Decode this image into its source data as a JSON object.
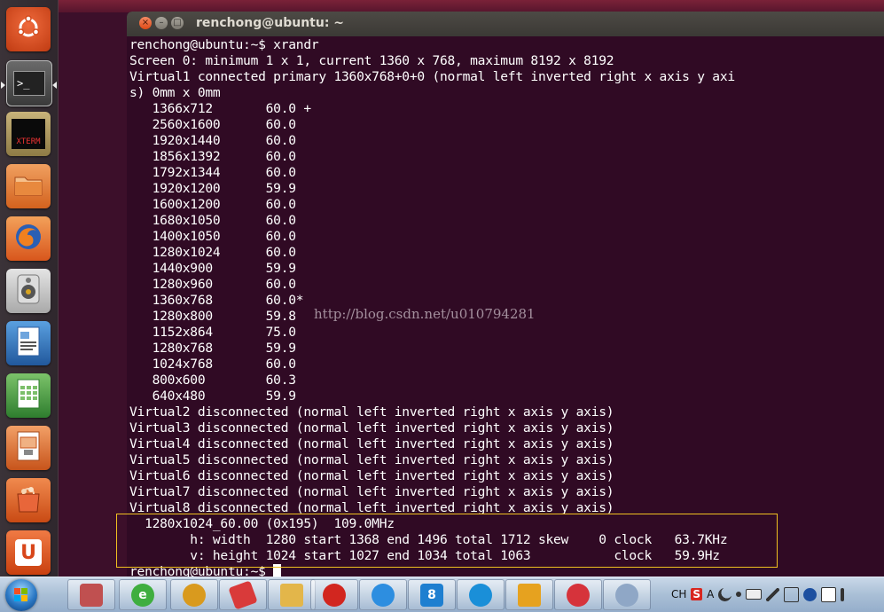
{
  "window": {
    "title": "renchong@ubuntu: ~",
    "close_glyph": "×",
    "min_glyph": "–",
    "max_glyph": "□"
  },
  "launcher": {
    "items": [
      {
        "name": "dash-home",
        "label": "",
        "color": "#d44b1e"
      },
      {
        "name": "terminal",
        "label": ">_",
        "color": "#2b2b2b"
      },
      {
        "name": "xterm",
        "label": "XTERM",
        "color": "#1a1a1a"
      },
      {
        "name": "files",
        "label": "",
        "color": "#e07b2e"
      },
      {
        "name": "firefox",
        "label": "",
        "color": "#e5672d"
      },
      {
        "name": "rhythmbox",
        "label": "",
        "color": "#c9c9c9"
      },
      {
        "name": "writer",
        "label": "",
        "color": "#2f6fb7"
      },
      {
        "name": "calc",
        "label": "",
        "color": "#3f9a3f"
      },
      {
        "name": "impress",
        "label": "",
        "color": "#d86f2b"
      },
      {
        "name": "software-center",
        "label": "",
        "color": "#e0662a"
      },
      {
        "name": "ubuntu-one",
        "label": "U",
        "color": "#e2571f"
      }
    ]
  },
  "terminal": {
    "lines": [
      "renchong@ubuntu:~$ xrandr",
      "Screen 0: minimum 1 x 1, current 1360 x 768, maximum 8192 x 8192",
      "Virtual1 connected primary 1360x768+0+0 (normal left inverted right x axis y axi",
      "s) 0mm x 0mm",
      "   1366x712       60.0 +",
      "   2560x1600      60.0",
      "   1920x1440      60.0",
      "   1856x1392      60.0",
      "   1792x1344      60.0",
      "   1920x1200      59.9",
      "   1600x1200      60.0",
      "   1680x1050      60.0",
      "   1400x1050      60.0",
      "   1280x1024      60.0",
      "   1440x900       59.9",
      "   1280x960       60.0",
      "   1360x768       60.0*",
      "   1280x800       59.8",
      "   1152x864       75.0",
      "   1280x768       59.9",
      "   1024x768       60.0",
      "   800x600        60.3",
      "   640x480        59.9",
      "Virtual2 disconnected (normal left inverted right x axis y axis)",
      "Virtual3 disconnected (normal left inverted right x axis y axis)",
      "Virtual4 disconnected (normal left inverted right x axis y axis)",
      "Virtual5 disconnected (normal left inverted right x axis y axis)",
      "Virtual6 disconnected (normal left inverted right x axis y axis)",
      "Virtual7 disconnected (normal left inverted right x axis y axis)",
      "Virtual8 disconnected (normal left inverted right x axis y axis)",
      "  1280x1024_60.00 (0x195)  109.0MHz",
      "        h: width  1280 start 1368 end 1496 total 1712 skew    0 clock   63.7KHz",
      "        v: height 1024 start 1027 end 1034 total 1063           clock   59.9Hz",
      "renchong@ubuntu:~$ "
    ],
    "watermark": "http://blog.csdn.net/u010794281",
    "highlight_color": "#f0c020"
  },
  "taskbar": {
    "items": [
      {
        "name": "user-profile",
        "color": "#c05050",
        "glyph": ""
      },
      {
        "name": "360-browser",
        "color": "#3fae3f",
        "glyph": "e"
      },
      {
        "name": "magnifier-tool",
        "color": "#d99a1e",
        "glyph": ""
      },
      {
        "name": "paint-tool",
        "color": "#d93a3a",
        "glyph": ""
      },
      {
        "name": "file-explorer",
        "color": "#e3b64a",
        "glyph": ""
      },
      {
        "name": "netease-music",
        "color": "#d2261f",
        "glyph": ""
      },
      {
        "name": "notes-app",
        "color": "#2d8ee0",
        "glyph": ""
      },
      {
        "name": "app-8",
        "color": "#1e7fd0",
        "glyph": "8"
      },
      {
        "name": "feiq-app",
        "color": "#1a8fd8",
        "glyph": ""
      },
      {
        "name": "vmware-app",
        "color": "#e6a21f",
        "glyph": ""
      },
      {
        "name": "xmind-app",
        "color": "#d6333b",
        "glyph": ""
      },
      {
        "name": "paint-palette",
        "color": "#8fa7c6",
        "glyph": ""
      }
    ],
    "tray": {
      "lang": "CH",
      "ime": "S",
      "font_glyph": "A"
    }
  }
}
